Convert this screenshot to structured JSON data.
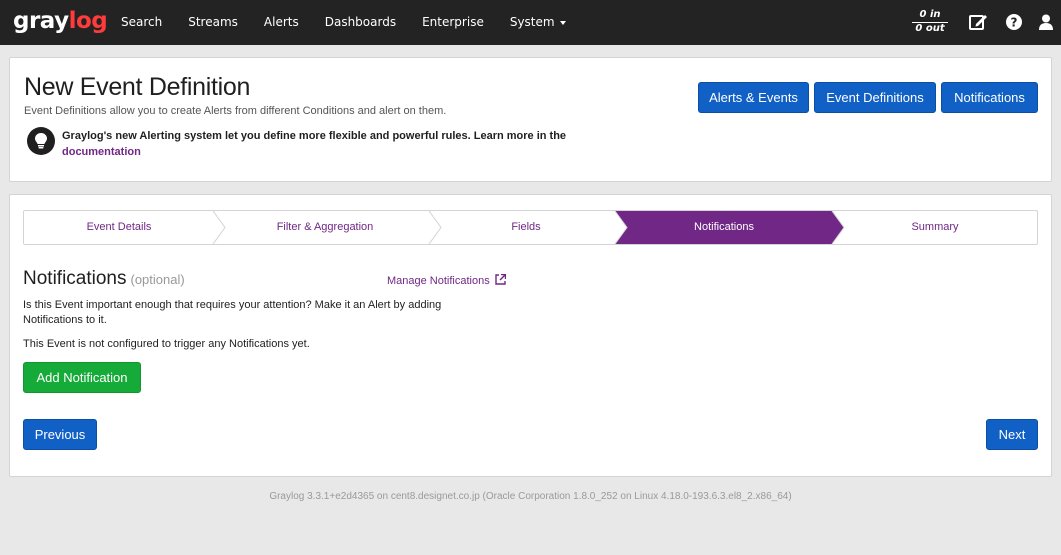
{
  "navbar": {
    "logo_main": "gray",
    "logo_accent": "log",
    "links": [
      "Search",
      "Streams",
      "Alerts",
      "Dashboards",
      "Enterprise",
      "System"
    ],
    "throughput_in": "0 in",
    "throughput_out": "0 out",
    "icons": [
      "edit-icon",
      "help-icon",
      "user-icon"
    ]
  },
  "header": {
    "title": "New Event Definition",
    "description": "Event Definitions allow you to create Alerts from different Conditions and alert on them.",
    "info_text": "Graylog's new Alerting system let you define more flexible and powerful rules. Learn more in the",
    "info_link": "documentation",
    "buttons": [
      "Alerts & Events",
      "Event Definitions",
      "Notifications"
    ]
  },
  "wizard": {
    "steps": [
      "Event Details",
      "Filter & Aggregation",
      "Fields",
      "Notifications",
      "Summary"
    ],
    "active_step": 3
  },
  "notifications": {
    "title": "Notifications",
    "optional": "(optional)",
    "manage_link": "Manage Notifications",
    "prompt": "Is this Event important enough that requires your attention? Make it an Alert by adding Notifications to it.",
    "status": "This Event is not configured to trigger any Notifications yet.",
    "add_button": "Add Notification"
  },
  "nav_buttons": {
    "previous": "Previous",
    "next": "Next"
  },
  "footer": "Graylog 3.3.1+e2d4365 on cent8.designet.co.jp (Oracle Corporation 1.8.0_252 on Linux 4.18.0-193.6.3.el8_2.x86_64)",
  "colors": {
    "navbar": "#232323",
    "primary": "#1060c5",
    "success": "#16ab39",
    "accent": "#702785",
    "logo_accent": "#ff3b3b"
  }
}
